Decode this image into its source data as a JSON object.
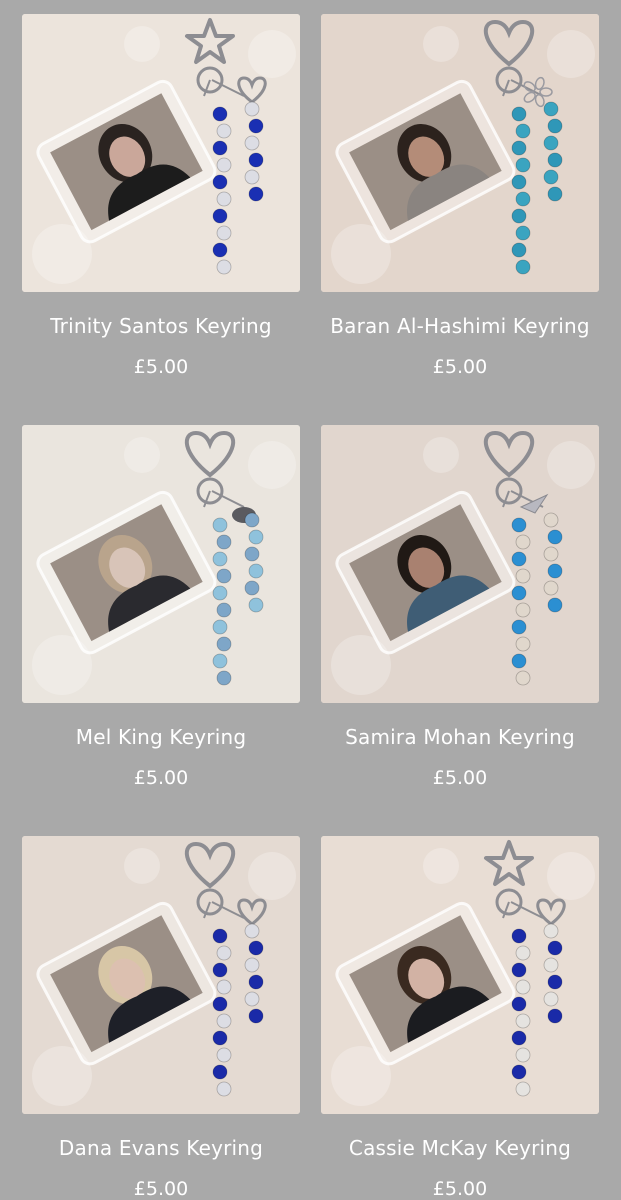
{
  "products": [
    {
      "name": "Trinity Santos Keyring",
      "price": "£5.00",
      "bg": "#ece4dc",
      "bead": "#1a2fb3",
      "bead2": "#dcdde4",
      "hair": "#2a2320",
      "skin": "#caa79a",
      "top": "#1c1c1c",
      "clip": "star-clasp-icon",
      "charm": "heart-charm-icon"
    },
    {
      "name": "Baran Al-Hashimi Keyring",
      "price": "£5.00",
      "bg": "#e3d6cc",
      "bead": "#2f97b8",
      "bead2": "#3aa4c0",
      "hair": "#2c221d",
      "skin": "#b48c78",
      "top": "#8a8480",
      "clip": "heart-clasp-icon",
      "charm": "flower-charm-icon"
    },
    {
      "name": "Mel King Keyring",
      "price": "£5.00",
      "bg": "#eae5de",
      "bead": "#8fc2dc",
      "bead2": "#7ea6c8",
      "hair": "#b9a48c",
      "skin": "#d8c4b8",
      "top": "#2a2a2f",
      "clip": "heart-clasp-icon",
      "charm": "turtle-charm-icon"
    },
    {
      "name": "Samira Mohan Keyring",
      "price": "£5.00",
      "bg": "#e1d6ce",
      "bead": "#2b8fd2",
      "bead2": "#e0d7cc",
      "hair": "#201915",
      "skin": "#a98170",
      "top": "#3f5d75",
      "clip": "heart-clasp-icon",
      "charm": "plane-charm-icon"
    },
    {
      "name": "Dana Evans Keyring",
      "price": "£5.00",
      "bg": "#e4dad2",
      "bead": "#1a2aa8",
      "bead2": "#dcdde4",
      "hair": "#d7c6a6",
      "skin": "#dcc0b0",
      "top": "#1e2028",
      "clip": "heart-clasp-icon",
      "charm": "heart-charm-icon"
    },
    {
      "name": "Cassie McKay Keyring",
      "price": "£5.00",
      "bg": "#e8ddd4",
      "bead": "#1a2aa8",
      "bead2": "#e5e3e0",
      "hair": "#3a2a20",
      "skin": "#d2b2a4",
      "top": "#1b1c20",
      "clip": "star-clasp-icon",
      "charm": "heart-charm-icon"
    }
  ]
}
